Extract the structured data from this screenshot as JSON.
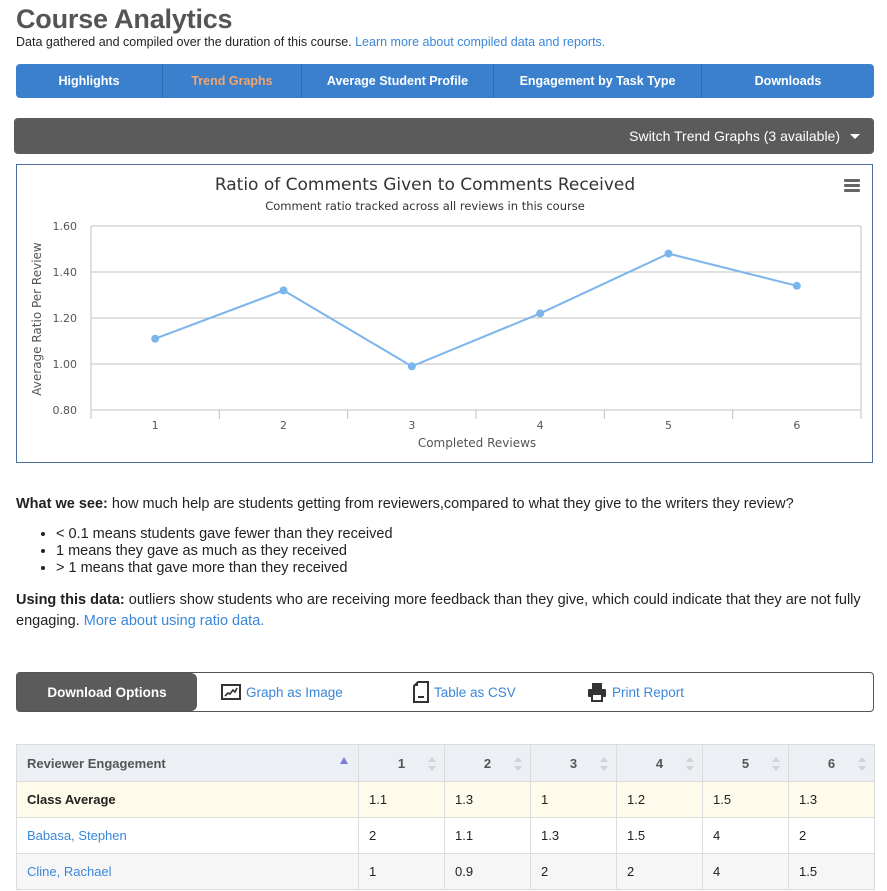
{
  "page": {
    "title": "Course Analytics",
    "subtitle": "Data gathered and compiled over the duration of this course.",
    "subtitle_link": "Learn more about compiled data and reports."
  },
  "tabs": [
    {
      "label": "Highlights",
      "active": false
    },
    {
      "label": "Trend Graphs",
      "active": true
    },
    {
      "label": "Average Student Profile",
      "active": false
    },
    {
      "label": "Engagement by Task Type",
      "active": false
    },
    {
      "label": "Downloads",
      "active": false
    }
  ],
  "switch_bar": {
    "label": "Switch Trend Graphs (3 available)"
  },
  "colors": {
    "tab_bg": "#3a80cc",
    "tab_active_text": "#f5a46a",
    "dark_bar": "#5b5b5b",
    "series": "#7cb5ec",
    "link": "#3a87d9",
    "avg_row_bg": "#fefbea"
  },
  "chart_data": {
    "type": "line",
    "title": "Ratio of Comments Given to Comments Received",
    "subtitle": "Comment ratio tracked across all reviews in this course",
    "xlabel": "Completed Reviews",
    "ylabel": "Average Ratio Per Review",
    "categories": [
      "1",
      "2",
      "3",
      "4",
      "5",
      "6"
    ],
    "series": [
      {
        "name": "Average Ratio",
        "values": [
          1.11,
          1.32,
          0.99,
          1.22,
          1.48,
          1.34
        ]
      }
    ],
    "ylim": [
      0.8,
      1.6
    ],
    "yticks": [
      "0.80",
      "1.00",
      "1.20",
      "1.40",
      "1.60"
    ],
    "grid": true,
    "legend": "none"
  },
  "description": {
    "what_label": "What we see:",
    "what_text": " how much help are students getting from reviewers,compared to what they give to the writers they review?",
    "bullets": [
      "< 0.1 means students gave fewer than they received",
      "1 means they gave as much as they received",
      "> 1 means that gave more than they received"
    ],
    "using_label": "Using this data:",
    "using_text": " outliers show students who are receiving more feedback than they give, which could indicate that they are not fully engaging.",
    "using_link": "More about using ratio data."
  },
  "downloads": {
    "title": "Download Options",
    "graph_image": "Graph as Image",
    "table_csv": "Table as CSV",
    "print_report": "Print Report"
  },
  "table": {
    "headers": [
      "Reviewer Engagement",
      "1",
      "2",
      "3",
      "4",
      "5",
      "6"
    ],
    "rows": [
      {
        "name": "Class Average",
        "values": [
          "1.1",
          "1.3",
          "1",
          "1.2",
          "1.5",
          "1.3"
        ]
      },
      {
        "name": "Babasa, Stephen",
        "values": [
          "2",
          "1.1",
          "1.3",
          "1.5",
          "4",
          "2"
        ]
      },
      {
        "name": "Cline, Rachael",
        "values": [
          "1",
          "0.9",
          "2",
          "2",
          "4",
          "1.5"
        ]
      }
    ]
  }
}
